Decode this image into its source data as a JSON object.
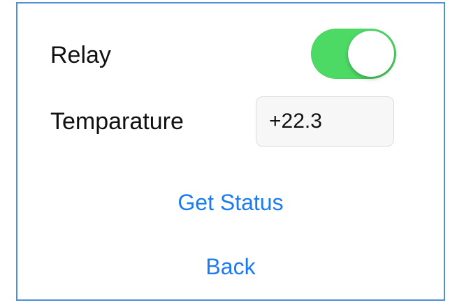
{
  "relay": {
    "label": "Relay",
    "on": true
  },
  "temperature": {
    "label": "Temparature",
    "value": "+22.3"
  },
  "actions": {
    "get_status_label": "Get Status",
    "back_label": "Back"
  },
  "colors": {
    "accent": "#1a7cf0",
    "toggle_on": "#4cd964",
    "frame_border": "#4f8fd6"
  }
}
